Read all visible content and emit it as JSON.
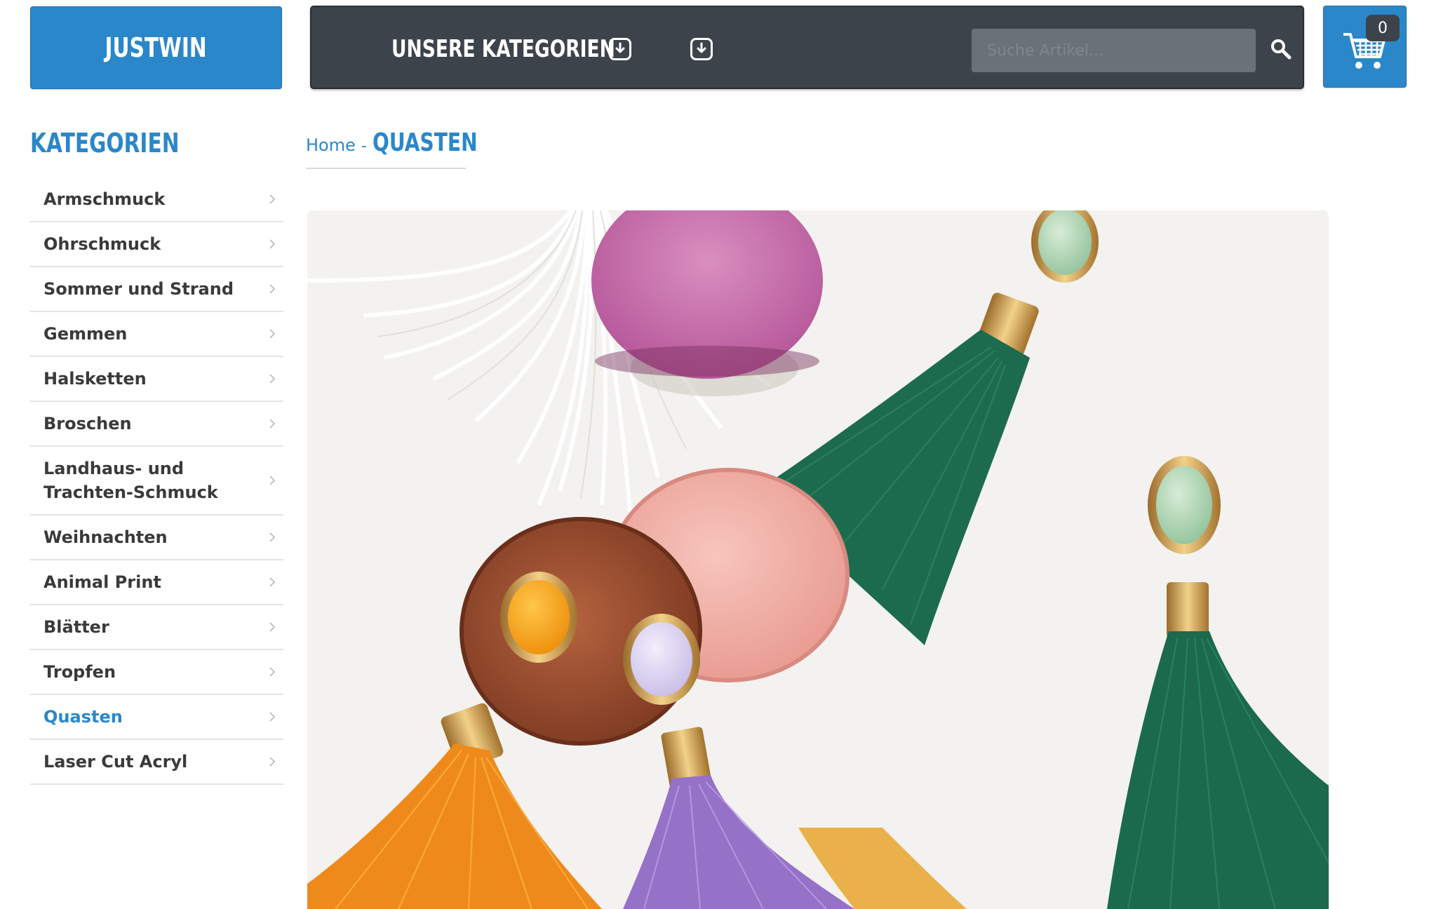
{
  "header": {
    "logo": "JUSTWIN",
    "nav_categories_label": "UNSERE KATEGORIEN",
    "search_placeholder": "Suche Artikel...",
    "cart_count": "0"
  },
  "sidebar": {
    "title": "KATEGORIEN",
    "items": [
      {
        "label": "Armschmuck"
      },
      {
        "label": "Ohrschmuck"
      },
      {
        "label": "Sommer und Strand"
      },
      {
        "label": "Gemmen"
      },
      {
        "label": "Halsketten"
      },
      {
        "label": "Broschen"
      },
      {
        "label": "Landhaus- und Trachten-Schmuck"
      },
      {
        "label": "Weihnachten"
      },
      {
        "label": "Animal Print"
      },
      {
        "label": "Blätter"
      },
      {
        "label": "Tropfen"
      },
      {
        "label": "Quasten"
      },
      {
        "label": "Laser Cut Acryl"
      }
    ]
  },
  "breadcrumb": {
    "home": "Home",
    "separator": "-",
    "current": "QUASTEN"
  },
  "colors": {
    "brand_blue": "#2a87c9",
    "nav_dark": "#3d434a",
    "text_dark": "#3a3a3a"
  },
  "icons": {
    "nav_download_1": "download-icon",
    "nav_download_2": "download-icon",
    "search": "search-icon",
    "cart": "cart-icon",
    "chevron": "chevron-right-icon"
  }
}
